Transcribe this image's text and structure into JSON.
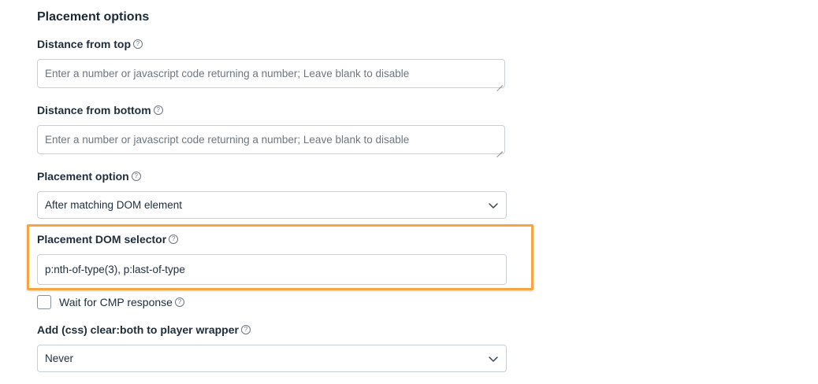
{
  "section": {
    "title": "Placement options"
  },
  "help_glyph": "?",
  "fields": {
    "distance_top": {
      "label": "Distance from top",
      "placeholder": "Enter a number or javascript code returning a number; Leave blank to disable"
    },
    "distance_bottom": {
      "label": "Distance from bottom",
      "placeholder": "Enter a number or javascript code returning a number; Leave blank to disable"
    },
    "placement_option": {
      "label": "Placement option",
      "value": "After matching DOM element"
    },
    "placement_selector": {
      "label": "Placement DOM selector",
      "value": "p:nth-of-type(3), p:last-of-type"
    },
    "wait_cmp": {
      "label": "Wait for CMP response",
      "checked": false
    },
    "css_clear": {
      "label": "Add (css) clear:both to player wrapper",
      "value": "Never"
    }
  },
  "colors": {
    "highlight": "#f5a640",
    "border": "#c9ced3",
    "text": "#1f2d3a"
  },
  "icons": [
    "help-icon",
    "chevron-down-icon",
    "resize-grip-icon"
  ]
}
